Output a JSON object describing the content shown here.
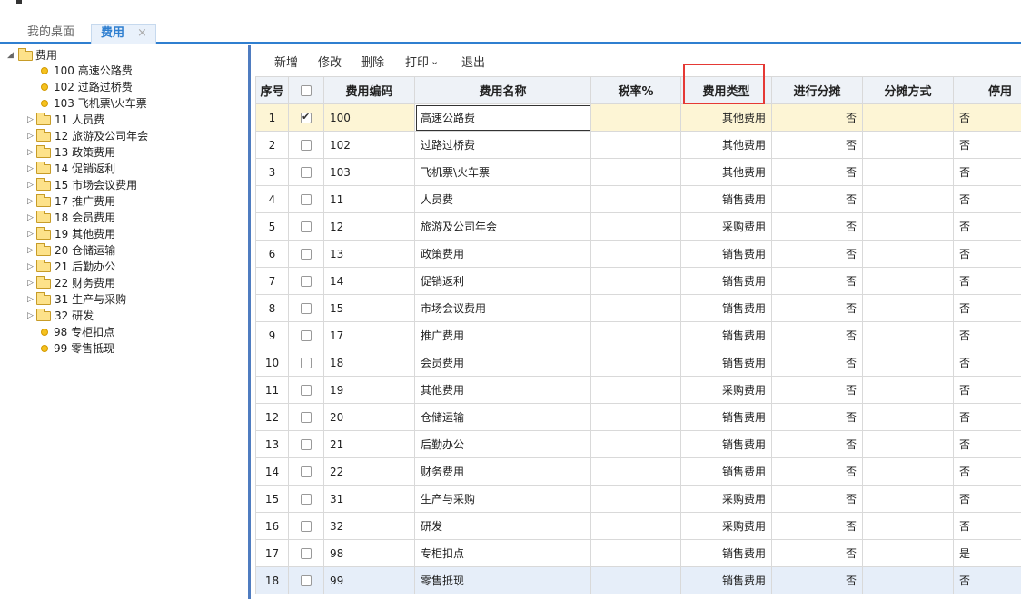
{
  "topbar": {
    "title": "",
    "subtitle": ""
  },
  "tabs": [
    {
      "label": "我的桌面"
    },
    {
      "label": "费用",
      "close": "×"
    }
  ],
  "tree": {
    "root": "费用",
    "items": [
      {
        "label": "100 高速公路费",
        "type": "leaf"
      },
      {
        "label": "102 过路过桥费",
        "type": "leaf"
      },
      {
        "label": "103 飞机票\\火车票",
        "type": "leaf"
      },
      {
        "label": "11 人员费",
        "type": "folder"
      },
      {
        "label": "12 旅游及公司年会",
        "type": "folder"
      },
      {
        "label": "13 政策费用",
        "type": "folder"
      },
      {
        "label": "14 促销返利",
        "type": "folder"
      },
      {
        "label": "15 市场会议费用",
        "type": "folder"
      },
      {
        "label": "17 推广费用",
        "type": "folder"
      },
      {
        "label": "18 会员费用",
        "type": "folder"
      },
      {
        "label": "19 其他费用",
        "type": "folder"
      },
      {
        "label": "20 仓储运输",
        "type": "folder"
      },
      {
        "label": "21 后勤办公",
        "type": "folder"
      },
      {
        "label": "22 财务费用",
        "type": "folder"
      },
      {
        "label": "31 生产与采购",
        "type": "folder"
      },
      {
        "label": "32 研发",
        "type": "folder"
      },
      {
        "label": "98 专柜扣点",
        "type": "leaf"
      },
      {
        "label": "99 零售抵现",
        "type": "leaf"
      }
    ]
  },
  "toolbar": {
    "add": "新增",
    "edit": "修改",
    "delete": "删除",
    "print": "打印",
    "print_arrow": "⌄",
    "exit": "退出"
  },
  "table": {
    "headers": {
      "seq": "序号",
      "code": "费用编码",
      "name": "费用名称",
      "tax": "税率%",
      "type": "费用类型",
      "alloc": "进行分摊",
      "method": "分摊方式",
      "disabled": "停用"
    },
    "rows": [
      {
        "seq": "1",
        "checked": true,
        "code": "100",
        "name": "高速公路费",
        "tax": "",
        "type": "其他费用",
        "alloc": "否",
        "method": "",
        "disabled": "否"
      },
      {
        "seq": "2",
        "checked": false,
        "code": "102",
        "name": "过路过桥费",
        "tax": "",
        "type": "其他费用",
        "alloc": "否",
        "method": "",
        "disabled": "否"
      },
      {
        "seq": "3",
        "checked": false,
        "code": "103",
        "name": "飞机票\\火车票",
        "tax": "",
        "type": "其他费用",
        "alloc": "否",
        "method": "",
        "disabled": "否"
      },
      {
        "seq": "4",
        "checked": false,
        "code": "11",
        "name": "人员费",
        "tax": "",
        "type": "销售费用",
        "alloc": "否",
        "method": "",
        "disabled": "否"
      },
      {
        "seq": "5",
        "checked": false,
        "code": "12",
        "name": "旅游及公司年会",
        "tax": "",
        "type": "采购费用",
        "alloc": "否",
        "method": "",
        "disabled": "否"
      },
      {
        "seq": "6",
        "checked": false,
        "code": "13",
        "name": "政策费用",
        "tax": "",
        "type": "销售费用",
        "alloc": "否",
        "method": "",
        "disabled": "否"
      },
      {
        "seq": "7",
        "checked": false,
        "code": "14",
        "name": "促销返利",
        "tax": "",
        "type": "销售费用",
        "alloc": "否",
        "method": "",
        "disabled": "否"
      },
      {
        "seq": "8",
        "checked": false,
        "code": "15",
        "name": "市场会议费用",
        "tax": "",
        "type": "销售费用",
        "alloc": "否",
        "method": "",
        "disabled": "否"
      },
      {
        "seq": "9",
        "checked": false,
        "code": "17",
        "name": "推广费用",
        "tax": "",
        "type": "销售费用",
        "alloc": "否",
        "method": "",
        "disabled": "否"
      },
      {
        "seq": "10",
        "checked": false,
        "code": "18",
        "name": "会员费用",
        "tax": "",
        "type": "销售费用",
        "alloc": "否",
        "method": "",
        "disabled": "否"
      },
      {
        "seq": "11",
        "checked": false,
        "code": "19",
        "name": "其他费用",
        "tax": "",
        "type": "采购费用",
        "alloc": "否",
        "method": "",
        "disabled": "否"
      },
      {
        "seq": "12",
        "checked": false,
        "code": "20",
        "name": "仓储运输",
        "tax": "",
        "type": "销售费用",
        "alloc": "否",
        "method": "",
        "disabled": "否"
      },
      {
        "seq": "13",
        "checked": false,
        "code": "21",
        "name": "后勤办公",
        "tax": "",
        "type": "销售费用",
        "alloc": "否",
        "method": "",
        "disabled": "否"
      },
      {
        "seq": "14",
        "checked": false,
        "code": "22",
        "name": "财务费用",
        "tax": "",
        "type": "销售费用",
        "alloc": "否",
        "method": "",
        "disabled": "否"
      },
      {
        "seq": "15",
        "checked": false,
        "code": "31",
        "name": "生产与采购",
        "tax": "",
        "type": "采购费用",
        "alloc": "否",
        "method": "",
        "disabled": "否"
      },
      {
        "seq": "16",
        "checked": false,
        "code": "32",
        "name": "研发",
        "tax": "",
        "type": "采购费用",
        "alloc": "否",
        "method": "",
        "disabled": "否"
      },
      {
        "seq": "17",
        "checked": false,
        "code": "98",
        "name": "专柜扣点",
        "tax": "",
        "type": "销售费用",
        "alloc": "否",
        "method": "",
        "disabled": "是"
      },
      {
        "seq": "18",
        "checked": false,
        "code": "99",
        "name": "零售抵现",
        "tax": "",
        "type": "销售费用",
        "alloc": "否",
        "method": "",
        "disabled": "否"
      }
    ]
  },
  "colors": {
    "accent": "#2f7fd0",
    "highlight_box": "#e53935",
    "selected_row": "#fdf5d5",
    "hover_row": "#e6eef9"
  }
}
